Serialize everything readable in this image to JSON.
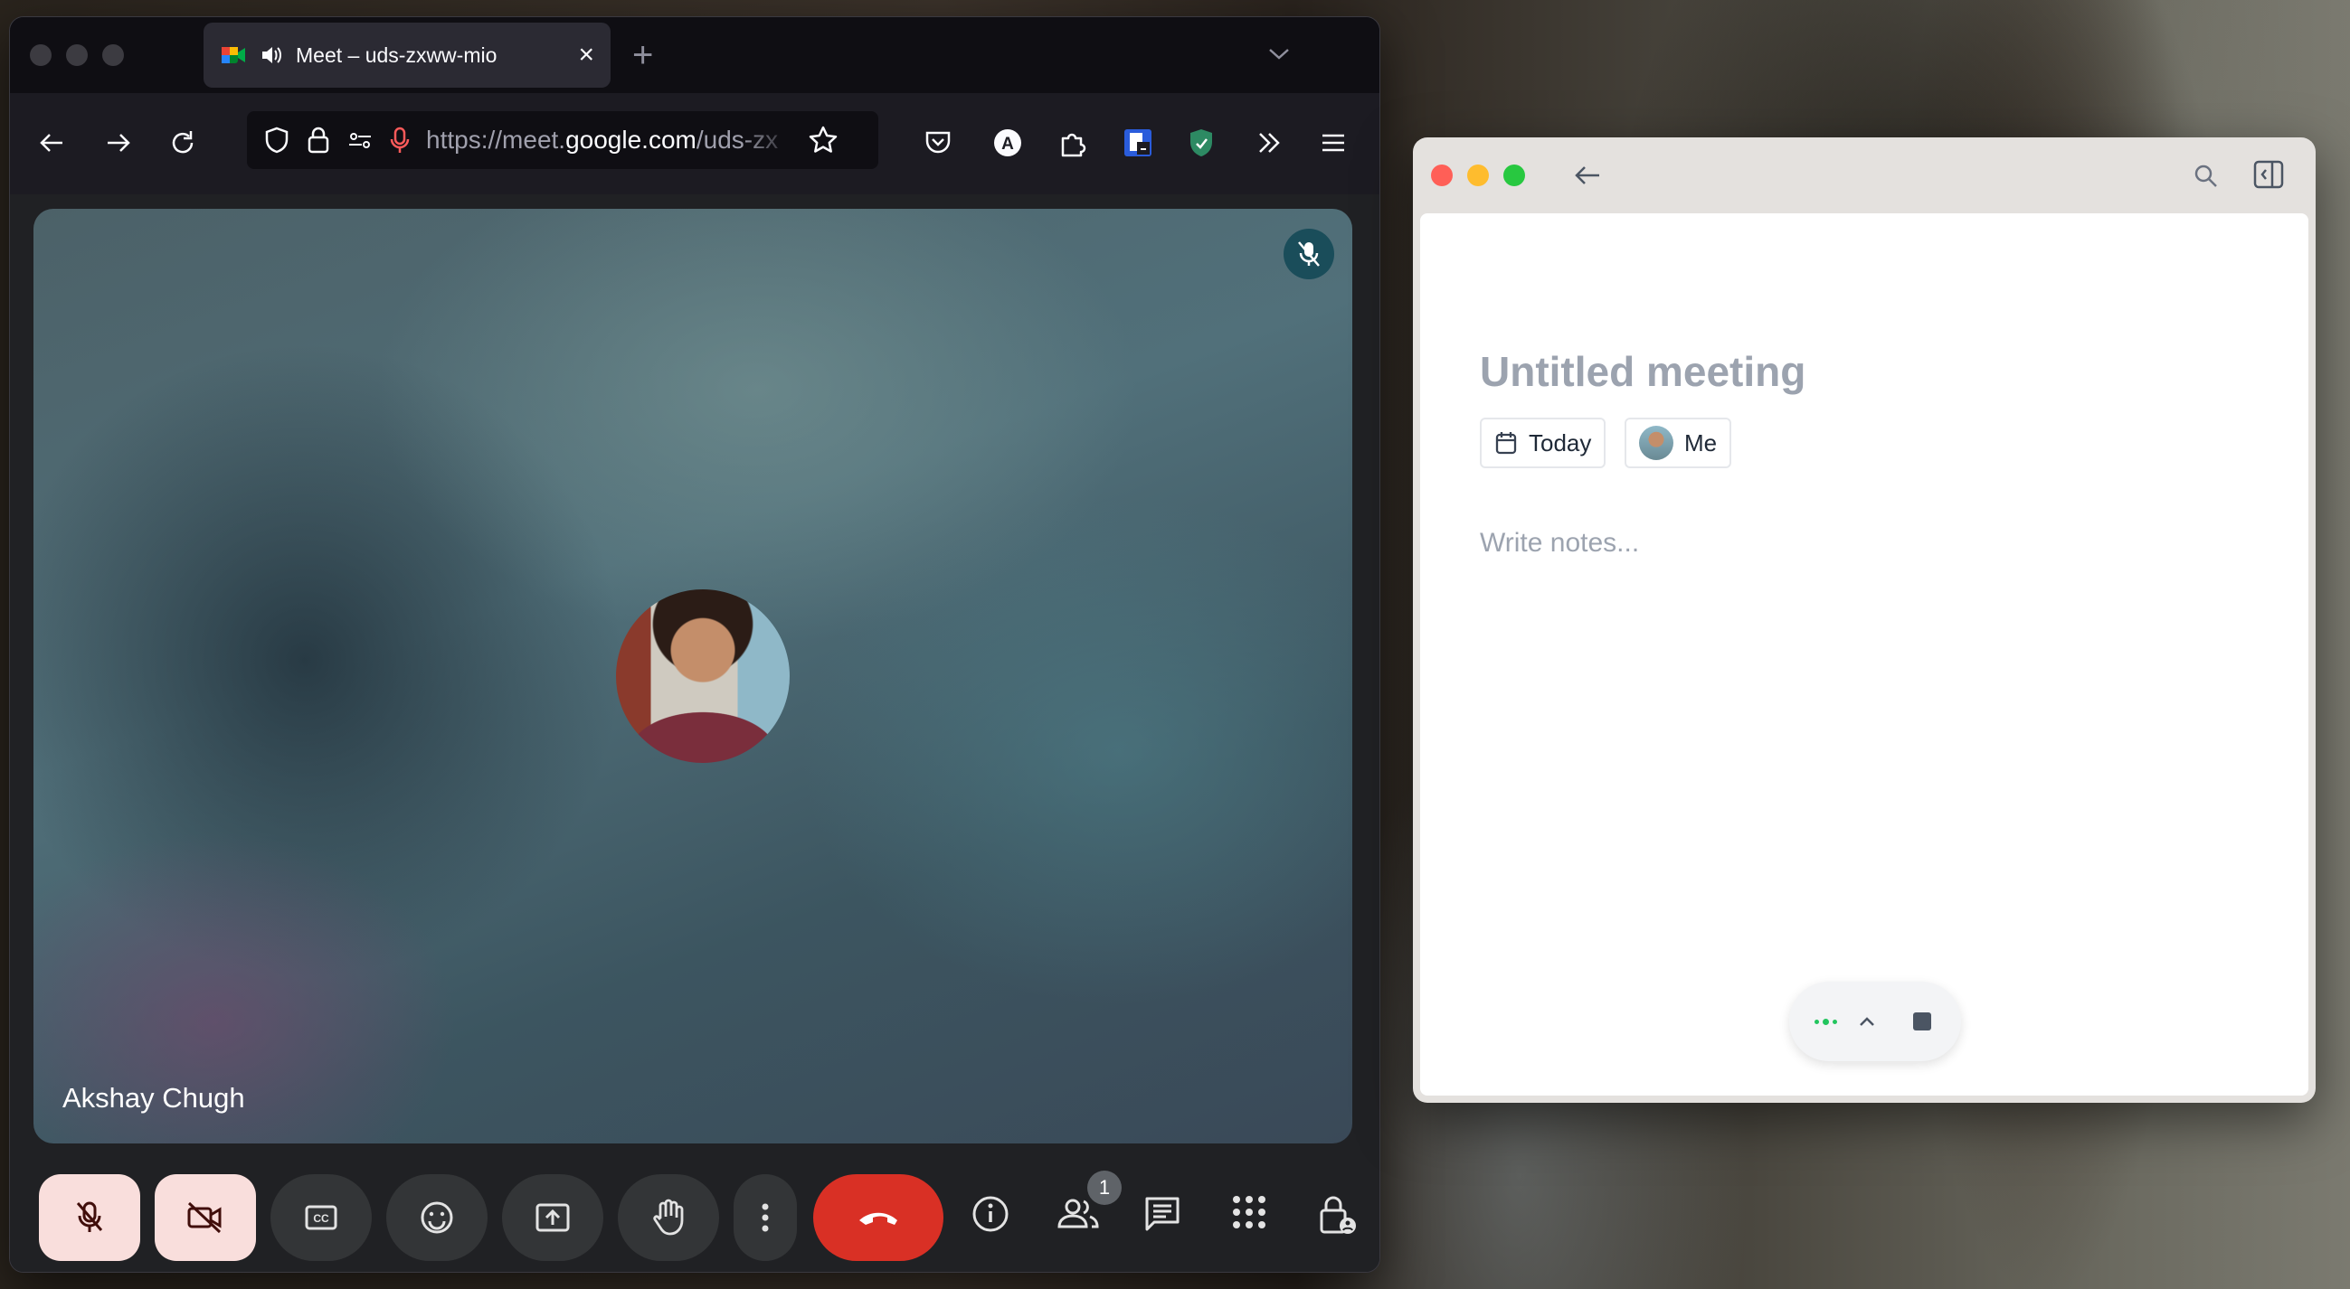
{
  "browser": {
    "tab": {
      "title": "Meet – uds-zxww-mio"
    },
    "address_bar": {
      "url_prefix": "https://meet.",
      "url_domain": "google.com",
      "url_path": "/uds-zx"
    }
  },
  "meet": {
    "participant_name": "Akshay Chugh",
    "participant_count": "1",
    "accent": "#d93025",
    "controls": [
      "microphone-off",
      "camera-off",
      "captions",
      "emoji",
      "present",
      "raise-hand",
      "more-options",
      "leave-call",
      "meeting-info",
      "people",
      "chat",
      "activities",
      "host-controls"
    ]
  },
  "notes_app": {
    "title": "Untitled meeting",
    "date_chip": "Today",
    "attendee_chip": "Me",
    "placeholder": "Write notes..."
  }
}
